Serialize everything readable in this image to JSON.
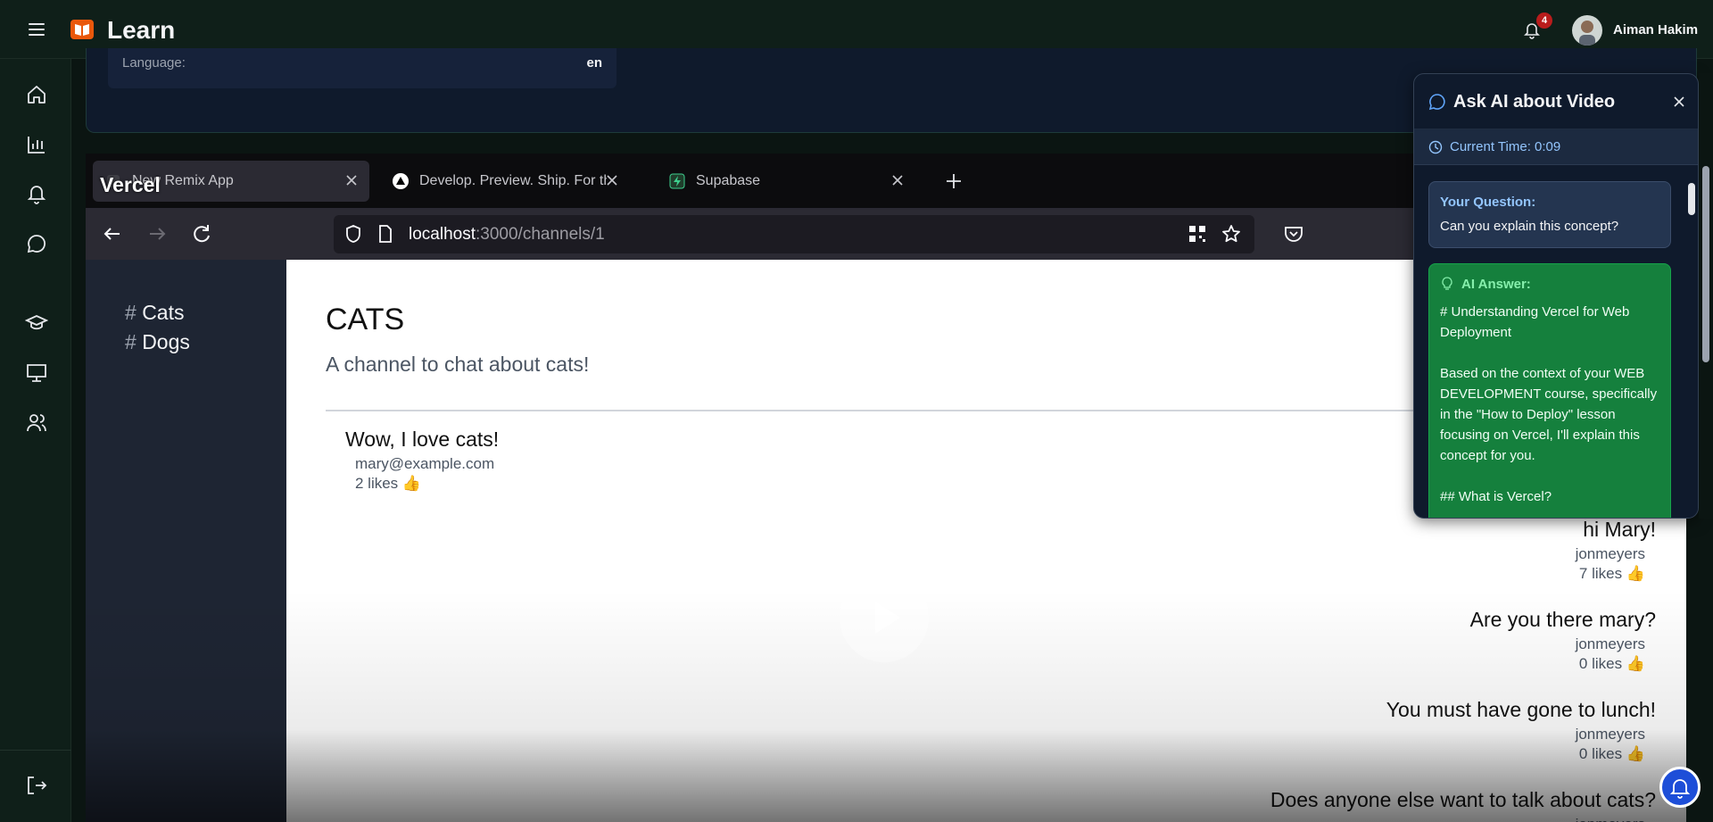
{
  "app": {
    "brand": "Learn",
    "notification_count": "4",
    "user_name": "Aiman Hakim"
  },
  "info": {
    "language_label": "Language:",
    "language_value": "en"
  },
  "video": {
    "overlay_title": "Vercel",
    "tabs": [
      {
        "title": "New Remix App"
      },
      {
        "title": "Develop. Preview. Ship. For the Best Frontend"
      },
      {
        "title": "Supabase"
      }
    ],
    "url_host": "localhost",
    "url_path": ":3000/channels/1",
    "channels": [
      {
        "hash": "#",
        "name": "Cats"
      },
      {
        "hash": "#",
        "name": "Dogs"
      }
    ],
    "channel_title": "CATS",
    "channel_desc": "A channel to chat about cats!",
    "messages": [
      {
        "body": "Wow, I love cats!",
        "author": "mary@example.com",
        "likes": "2 likes 👍"
      },
      {
        "body": "hi Mary!",
        "author": "jonmeyers",
        "likes": "7 likes 👍"
      },
      {
        "body": "Are you there mary?",
        "author": "jonmeyers",
        "likes": "0 likes 👍"
      },
      {
        "body": "You must have gone to lunch!",
        "author": "jonmeyers",
        "likes": "0 likes 👍"
      },
      {
        "body": "Does anyone else want to talk about cats?",
        "author": "jonmeyers",
        "likes": ""
      }
    ]
  },
  "ai_panel": {
    "title": "Ask AI about Video",
    "current_time": "Current Time: 0:09",
    "question_label": "Your Question:",
    "question": "Can you explain this concept?",
    "answer_label": "AI Answer:",
    "answer": "# Understanding Vercel for Web Deployment\n\nBased on the context of your WEB DEVELOPMENT course, specifically in the \"How to Deploy\" lesson focusing on Vercel, I'll explain this concept for you.\n\n## What is Vercel?"
  },
  "colors": {
    "accent": "#15803d",
    "brand_logo": "#ea580c",
    "sidebar_bg": "#0f1f19"
  },
  "icons": [
    "menu-icon",
    "book-logo-icon",
    "bell-icon",
    "home-icon",
    "chart-icon",
    "notification-icon",
    "chat-icon",
    "graduation-cap-icon",
    "presentation-icon",
    "users-icon",
    "logout-icon",
    "chat-bubble-icon",
    "clock-icon",
    "close-icon",
    "lightbulb-icon"
  ]
}
